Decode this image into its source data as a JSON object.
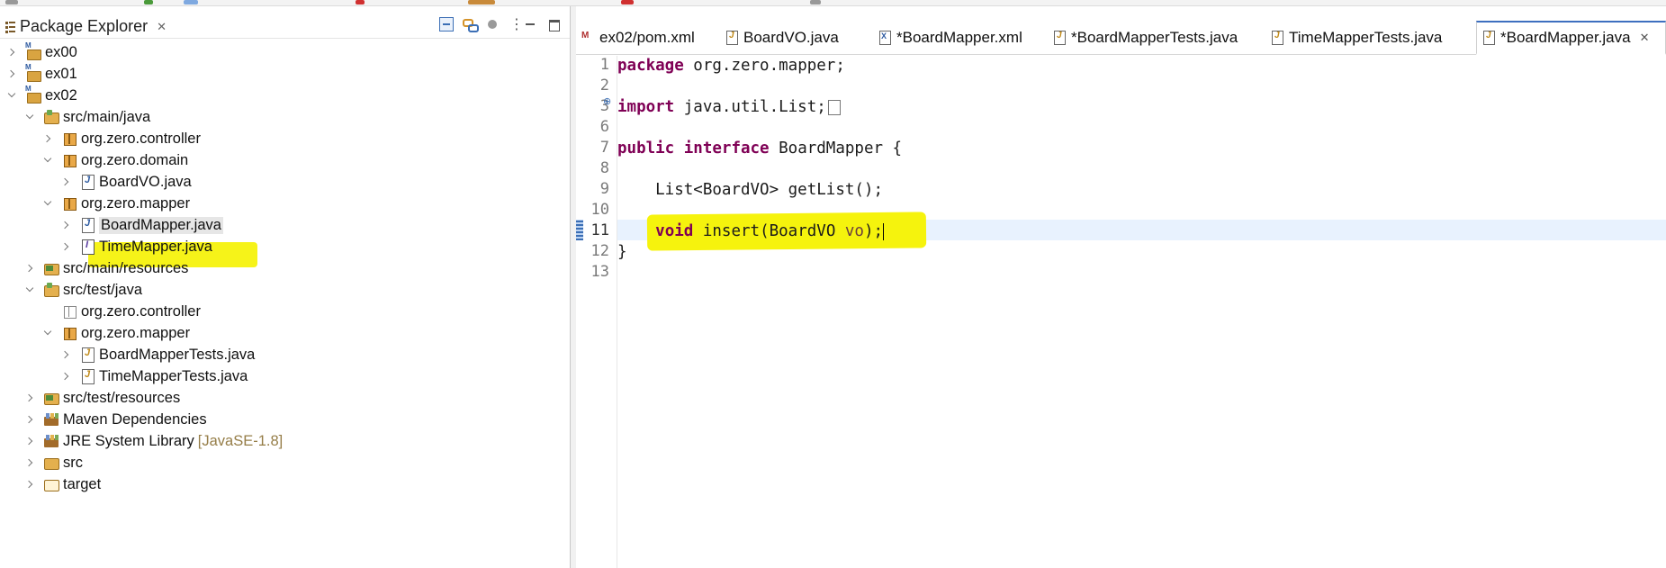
{
  "explorer": {
    "title": "Package Explorer",
    "tree": [
      {
        "label": "ex00",
        "icon": "maven-project-icon",
        "expanded": false
      },
      {
        "label": "ex01",
        "icon": "maven-project-icon",
        "expanded": false
      },
      {
        "label": "ex02",
        "icon": "maven-project-icon",
        "expanded": true
      },
      {
        "label": "src/main/java",
        "icon": "source-folder-icon",
        "expanded": true
      },
      {
        "label": "org.zero.controller",
        "icon": "package-icon",
        "expanded": false
      },
      {
        "label": "org.zero.domain",
        "icon": "package-icon",
        "expanded": true
      },
      {
        "label": "BoardVO.java",
        "icon": "java-file-icon",
        "expanded": false
      },
      {
        "label": "org.zero.mapper",
        "icon": "package-icon",
        "expanded": true
      },
      {
        "label": "BoardMapper.java",
        "icon": "java-file-icon",
        "expanded": false,
        "selected": true
      },
      {
        "label": "TimeMapper.java",
        "icon": "java-interface-icon",
        "expanded": false
      },
      {
        "label": "src/main/resources",
        "icon": "resource-folder-icon",
        "expanded": false
      },
      {
        "label": "src/test/java",
        "icon": "source-folder-icon",
        "expanded": true
      },
      {
        "label": "org.zero.controller",
        "icon": "empty-package-icon",
        "expanded": false
      },
      {
        "label": "org.zero.mapper",
        "icon": "package-icon",
        "expanded": true
      },
      {
        "label": "BoardMapperTests.java",
        "icon": "java-test-file-icon",
        "expanded": false
      },
      {
        "label": "TimeMapperTests.java",
        "icon": "java-test-file-icon",
        "expanded": false
      },
      {
        "label": "src/test/resources",
        "icon": "resource-folder-icon",
        "expanded": false
      },
      {
        "label": "Maven Dependencies",
        "icon": "library-icon",
        "expanded": false
      },
      {
        "label": "JRE System Library",
        "suffix": "[JavaSE-1.8]",
        "icon": "library-icon",
        "expanded": false
      },
      {
        "label": "src",
        "icon": "folder-icon",
        "expanded": false
      },
      {
        "label": "target",
        "icon": "folder-open-icon",
        "expanded": false
      }
    ]
  },
  "editor": {
    "tabs": [
      {
        "label": "ex02/pom.xml",
        "icon": "maven-pom-icon"
      },
      {
        "label": "BoardVO.java",
        "icon": "java-file-icon"
      },
      {
        "label": "*BoardMapper.xml",
        "icon": "xml-file-icon"
      },
      {
        "label": "*BoardMapperTests.java",
        "icon": "java-file-icon"
      },
      {
        "label": "TimeMapperTests.java",
        "icon": "java-file-icon"
      },
      {
        "label": "*BoardMapper.java",
        "icon": "java-file-icon",
        "active": true
      }
    ],
    "line_numbers": [
      "1",
      "2",
      "3",
      "6",
      "7",
      "8",
      "9",
      "10",
      "11",
      "12",
      "13"
    ],
    "code": {
      "l1_kw": "package",
      "l1_rest": " org.zero.mapper;",
      "l3_kw": "import",
      "l3_rest": " java.util.List;",
      "l7_kw1": "public",
      "l7_kw2": "interface",
      "l7_rest": " BoardMapper {",
      "l9": "    List<BoardVO> getList();",
      "l11_indent": "    ",
      "l11_kw": "void",
      "l11_mid": " insert(BoardVO ",
      "l11_param": "vo",
      "l11_end": ");",
      "l12": "}"
    },
    "current_line": "11"
  },
  "colors": {
    "keyword": "#7f0055",
    "highlight": "#f5f200",
    "current_line_bg": "#e8f2fe"
  }
}
